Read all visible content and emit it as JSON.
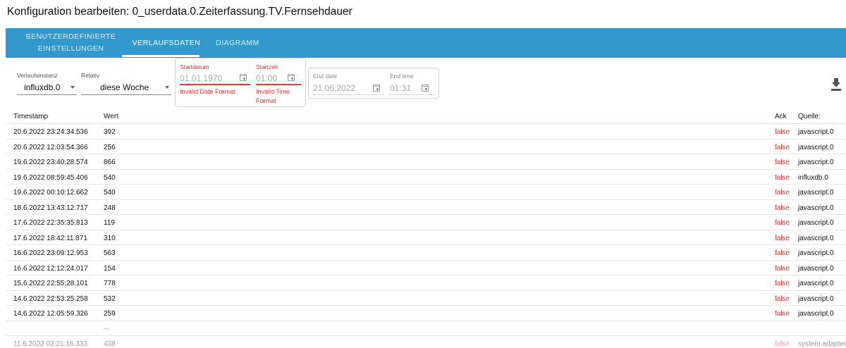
{
  "dialog": {
    "title": "Konfiguration bearbeiten: 0_userdata.0.Zeiterfassung.TV.Fernsehdauer"
  },
  "tabs": [
    {
      "label": "BENUTZERDEFINIERTE EINSTELLUNGEN",
      "active": false
    },
    {
      "label": "VERLAUFSDATEN",
      "active": true
    },
    {
      "label": "DIAGRAMM",
      "active": false
    }
  ],
  "filters": {
    "instance": {
      "label": "Verlaufsinstanz",
      "value": "influxdb.0"
    },
    "relative": {
      "label": "Relativ",
      "value": "diese Woche"
    },
    "start_date": {
      "label": "Startdatum",
      "value": "01.01.1970",
      "error": "Invalid Date Format"
    },
    "start_time": {
      "label": "Startzeit",
      "value": "01:00",
      "error": "Invalid Time Format"
    },
    "end_date": {
      "label": "End date",
      "value": "21.06.2022"
    },
    "end_time": {
      "label": "End time",
      "value": "01:31"
    }
  },
  "table": {
    "headers": {
      "timestamp": "Timestamp",
      "value": "Wert",
      "ack": "Ack",
      "source": "Quelle:"
    },
    "rows": [
      {
        "ts": "20.6.2022 23:24:34.536",
        "val": "392",
        "ack": "false",
        "src": "javascript.0"
      },
      {
        "ts": "20.6.2022 12:03:54.366",
        "val": "256",
        "ack": "false",
        "src": "javascript.0"
      },
      {
        "ts": "19.6.2022 23:40:28.574",
        "val": "866",
        "ack": "false",
        "src": "javascript.0"
      },
      {
        "ts": "19.6.2022 08:59:45.406",
        "val": "540",
        "ack": "false",
        "src": "influxdb.0"
      },
      {
        "ts": "19.6.2022 00:10:12.662",
        "val": "540",
        "ack": "false",
        "src": "javascript.0"
      },
      {
        "ts": "18.6.2022 13:43:12.717",
        "val": "248",
        "ack": "false",
        "src": "javascript.0"
      },
      {
        "ts": "17.6.2022 22:35:35.813",
        "val": "119",
        "ack": "false",
        "src": "javascript.0"
      },
      {
        "ts": "17.6.2022 18:42:11.871",
        "val": "310",
        "ack": "false",
        "src": "javascript.0"
      },
      {
        "ts": "16.6.2022 23:09:12.953",
        "val": "563",
        "ack": "false",
        "src": "javascript.0"
      },
      {
        "ts": "16.6.2022 12:12:24.017",
        "val": "154",
        "ack": "false",
        "src": "javascript.0"
      },
      {
        "ts": "15.6.2022 22:55:28.101",
        "val": "778",
        "ack": "false",
        "src": "javascript.0"
      },
      {
        "ts": "14.6.2022 22:53:25.258",
        "val": "532",
        "ack": "false",
        "src": "javascript.0"
      },
      {
        "ts": "14.6.2022 12:05:59.326",
        "val": "259",
        "ack": "false",
        "src": "javascript.0"
      }
    ],
    "ellipsis": "...",
    "outside_row": {
      "ts": "11.6.2022 02:21:16.333",
      "val": "438",
      "ack": "false",
      "src": "system.adapter.i"
    }
  },
  "icons": {
    "download": "download-icon",
    "calendar": "calendar-icon",
    "dropdown": "chevron-down-icon"
  },
  "colors": {
    "tabbar": "#3399cc",
    "error": "#e53935"
  }
}
